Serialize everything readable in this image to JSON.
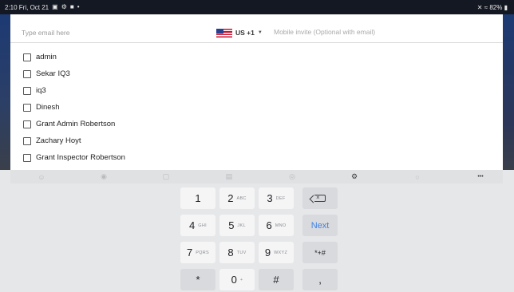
{
  "status_bar": {
    "time_date": "2:10  Fri, Oct 21",
    "battery": "82%"
  },
  "invite": {
    "email_placeholder": "Type email here",
    "country_code": "US +1",
    "mobile_placeholder": "Mobile invite (Optional with email)"
  },
  "users": [
    {
      "name": "admin",
      "checked": false
    },
    {
      "name": "Sekar IQ3",
      "checked": false
    },
    {
      "name": "iq3",
      "checked": false
    },
    {
      "name": "Dinesh",
      "checked": false
    },
    {
      "name": "Grant Admin Robertson",
      "checked": false
    },
    {
      "name": "Zachary Hoyt",
      "checked": false
    },
    {
      "name": "Grant Inspector Robertson",
      "checked": false
    }
  ],
  "keyboard": {
    "keys": {
      "k1": {
        "main": "1",
        "sub": ""
      },
      "k2": {
        "main": "2",
        "sub": "ABC"
      },
      "k3": {
        "main": "3",
        "sub": "DEF"
      },
      "k4": {
        "main": "4",
        "sub": "GHI"
      },
      "k5": {
        "main": "5",
        "sub": "JKL"
      },
      "k6": {
        "main": "6",
        "sub": "MNO"
      },
      "k7": {
        "main": "7",
        "sub": "PQRS"
      },
      "k8": {
        "main": "8",
        "sub": "TUV"
      },
      "k9": {
        "main": "9",
        "sub": "WXYZ"
      },
      "k0": {
        "main": "0",
        "sub": "+"
      },
      "star": {
        "main": "*"
      },
      "hash": {
        "main": "#"
      },
      "next": {
        "main": "Next"
      },
      "symbols": {
        "main": "*+#"
      },
      "comma": {
        "main": ","
      }
    },
    "toolbar_more": "•••"
  },
  "colors": {
    "accent_blue": "#3e82e6",
    "status_bar_bg": "#141822",
    "keyboard_bg": "#e6e7e9",
    "flag_red": "#c8102e",
    "flag_blue": "#2a3e8f"
  },
  "icons": {
    "status_bar": [
      "gallery-icon",
      "settings-icon",
      "notification-icon",
      "dot-icon",
      "mute-icon",
      "wifi-icon",
      "battery-icon"
    ],
    "keyboard_toolbar": [
      "emoji-icon",
      "sticker-icon",
      "gif-icon",
      "clipboard-icon",
      "voice-icon",
      "settings-icon",
      "search-icon",
      "more-icon"
    ]
  }
}
